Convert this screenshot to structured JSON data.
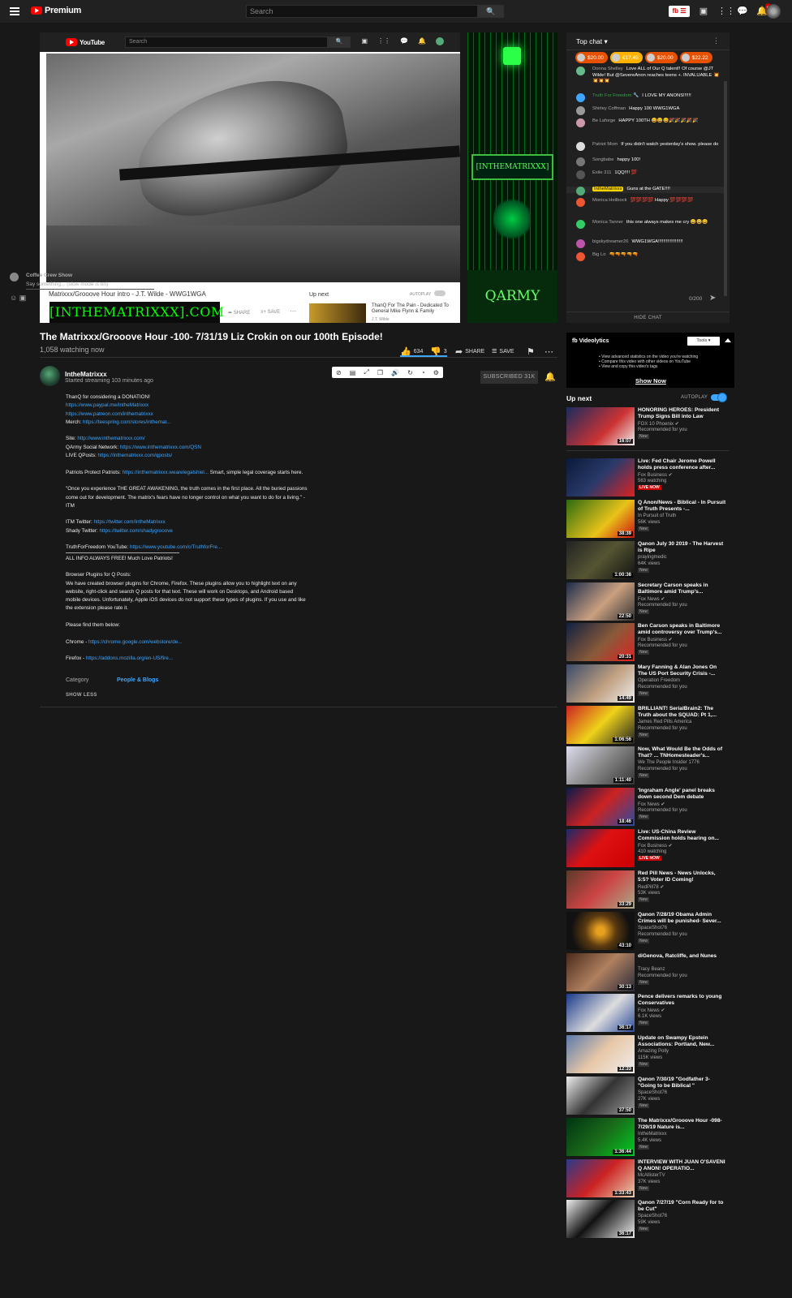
{
  "masthead": {
    "brand": "Premium",
    "search_placeholder": "Search",
    "notif_count": "9"
  },
  "inner_player": {
    "search_placeholder": "Search",
    "logo_text": "YouTube",
    "clip_title": "Matrixxx/Grooove Hour intro - J.T. Wilde - WWG1WGA",
    "banner_text": "[INTHEMATRIXXX].COM",
    "share": "SHARE",
    "save": "SAVE",
    "upnext": "Up next",
    "autoplay": "AUTOPLAY",
    "next_title": "ThanQ For The Pain - Dedicated To General Mike Flynn & Family",
    "next_channel": "J.T. Wilde"
  },
  "matrix_side": {
    "sign_text": "[INTHEMATRIXXX]",
    "qarmy": "QARMY"
  },
  "video": {
    "title": "The Matrixxx/Grooove Hour -100- 7/31/19 Liz Crokin on our 100th Episode!",
    "views": "1,058 watching now",
    "likes": "634",
    "dislikes": "3",
    "share": "SHARE",
    "save": "SAVE"
  },
  "owner": {
    "name": "IntheMatrixxx",
    "started": "Started streaming 103 minutes ago",
    "subscribe": "SUBSCRIBED  31K"
  },
  "description": {
    "lines": [
      {
        "t": "ThanQ for considering a DONATION!"
      },
      {
        "l": "https://www.paypal.me/IntheMatrixxx"
      },
      {
        "l": "https://www.patreon.com/inthematrixxx"
      },
      {
        "t": "Merch: ",
        "l": "https://teespring.com/stores/inthemat..."
      },
      {
        "gap": true
      },
      {
        "t": "Site: ",
        "l": "http://www.inthematrixxx.com/"
      },
      {
        "t": "QArmy Social Network: ",
        "l": "https://www.inthematrixxx.com/QSN"
      },
      {
        "t": "LIVE QPosts: ",
        "l": "https://inthematrixxx.com/qposts/"
      },
      {
        "gap": true
      },
      {
        "t": "Patriots Protect Patriots: ",
        "l": "https://inthematrixxx.wearelegalshiel...",
        "t2": " Smart, simple legal coverage starts here."
      },
      {
        "gap": true
      },
      {
        "t": "\"Once you experience THE GREAT AWAKENING, the truth comes in the first place. All the buried passions"
      },
      {
        "t": "come out for development. The matrix's fears have no longer control on what you want to do for a living.\" -"
      },
      {
        "t": "ITM"
      },
      {
        "gap": true
      },
      {
        "t": "ITM Twitter: ",
        "l": "https://twitter.com/IntheMatrixxx"
      },
      {
        "t": "Shady Twitter: ",
        "l": "https://twitter.com/shadygrooove"
      },
      {
        "gap": true
      },
      {
        "t": "TruthForFreedom YouTube: ",
        "l": "https://www.youtube.com/c/TruthforFre..."
      },
      {
        "rule": true
      },
      {
        "t": "ALL INFO ALWAYS FREE! Much Love Patriots!"
      },
      {
        "gap": true
      },
      {
        "t": "Browser Plugins for Q Posts:"
      },
      {
        "t": "We have created browser plugins for Chrome, Firefox.  These plugins allow you to highlight text on any"
      },
      {
        "t": "website, right-click and search Q posts for that text.  These will work on Desktops, and Android based"
      },
      {
        "t": "mobile devices.  Unfortunately, Apple iOS devices do not support these types of plugins.  If you use and like"
      },
      {
        "t": "the extension please rate it."
      },
      {
        "gap": true
      },
      {
        "t": "Please find them below:"
      },
      {
        "gap": true
      },
      {
        "t": "Chrome - ",
        "l": "https://chrome.google.com/webstore/de..."
      },
      {
        "gap": true
      },
      {
        "t": "Firefox - ",
        "l": "https://addons.mozilla.org/en-US/fire..."
      }
    ],
    "category_label": "Category",
    "category_value": "People & Blogs",
    "show_less": "SHOW LESS"
  },
  "chat": {
    "header": "Top chat",
    "tickers": [
      {
        "amount": "$20.00",
        "color": "#e65100"
      },
      {
        "amount": "€17.45",
        "color": "#ffb300"
      },
      {
        "amount": "$20.00",
        "color": "#e65100"
      },
      {
        "amount": "$22.22",
        "color": "#e65100"
      }
    ],
    "messages": [
      {
        "author": "Donna Shelley",
        "text": "Love ALL of Our Q talent!! Of course @JT Wilde! But @SevereAnon reaches teens +. INVALUABLE 💥💥💥💥",
        "style": ""
      },
      {
        "author": "Truth For Freedom 🔧",
        "text": "I LOVE MY ANONS!!!!!!",
        "style": "mem"
      },
      {
        "author": "Shirley Coffman",
        "text": "Happy 100 WWG1WGA",
        "style": ""
      },
      {
        "author": "Be Laforge",
        "text": "HAPPY 100TH 😀😀😀🎉🎉🎉🎉🎉",
        "style": ""
      },
      {
        "author": "Patriot Mom",
        "text": "If you didn't watch yesterday's show. please do",
        "style": ""
      },
      {
        "author": "Songbabe",
        "text": "happy 100!",
        "style": ""
      },
      {
        "author": "Exile 311",
        "text": "1QQ!!!! 💯",
        "style": ""
      },
      {
        "author": "IntheMatrixxx",
        "text": "Guns at the GATE!!!!",
        "style": "hl"
      },
      {
        "author": "Monica Heilbock",
        "text": "💯💯💯💯 Happy 💯💯💯💯",
        "style": ""
      },
      {
        "author": "Monica Tanner",
        "text": "this one always makes me cry 😀😀😀",
        "style": ""
      },
      {
        "author": "bigskydreamer26",
        "text": "WWG1WGA!!!!!!!!!!!!!!!!!!!",
        "style": ""
      },
      {
        "author": "Big Lo",
        "text": "🔫🔫🔫🔫🔫",
        "style": ""
      }
    ],
    "input_name": "Coffee Crew Show",
    "input_placeholder": "Say something... (slow mode is on)",
    "counter": "0/200",
    "hide_chat": "HIDE CHAT"
  },
  "videolytics": {
    "title": "Videolytics",
    "tools": "Tools",
    "bullets": [
      "View advanced statistics on the video you're watching",
      "Compare this video with other videos on YouTube",
      "View and copy this video's tags"
    ],
    "show_now": "Show Now"
  },
  "sidebar": {
    "upnext": "Up next",
    "autoplay": "AUTOPLAY",
    "items": [
      {
        "title": "HONORING HEROES: President Trump Signs Bill into Law",
        "channel": "FOX 10 Phoenix ✔",
        "meta": "Recommended for you",
        "badge": "New",
        "dur": "16:07",
        "bg": "linear-gradient(135deg,#1a2b5e,#c33 60%,#eee)"
      },
      {
        "title": "Live: Fed Chair Jerome Powell holds press conference after...",
        "channel": "Fox Business ✔",
        "meta": "563 watching",
        "badge": "LIVE NOW",
        "dur": "",
        "bg": "linear-gradient(135deg,#0a1a3a,#2a3a6a 50%,#d22)"
      },
      {
        "title": "Q Anon/News - Biblical - In Pursuit of Truth Presents -...",
        "channel": "In Pursuit of Truth",
        "meta": "56K views",
        "badge": "New",
        "dur": "38:39",
        "bg": "linear-gradient(135deg,#2c6b10,#e8c31a 60%,#c11)"
      },
      {
        "title": "Qanon July 30 2019 - The Harvest is Ripe",
        "channel": "prayingmedic",
        "meta": "64K views",
        "badge": "New",
        "dur": "1:00:36",
        "bg": "linear-gradient(135deg,#222,#553 50%,#111)"
      },
      {
        "title": "Secretary Carson speaks in Baltimore amid Trump's...",
        "channel": "Fox News ✔",
        "meta": "Recommended for you",
        "badge": "New",
        "dur": "22:50",
        "bg": "linear-gradient(135deg,#1c2c4c,#caa080 55%,#333)"
      },
      {
        "title": "Ben Carson speaks in Baltimore amid controversy over Trump's...",
        "channel": "Fox Business ✔",
        "meta": "Recommended for you",
        "badge": "New",
        "dur": "20:31",
        "bg": "linear-gradient(135deg,#102040,#8a5a3a 55%,#d22)"
      },
      {
        "title": "Mary Fanning & Alan Jones On The US Port Security Crisis -...",
        "channel": "Operation Freedom",
        "meta": "Recommended for you",
        "badge": "New",
        "dur": "14:49",
        "bg": "linear-gradient(135deg,#3a4a6a,#c0a080 55%,#eee)"
      },
      {
        "title": "BRILLIANT! SerialBrain2: The Truth about the SQUAD: Pt 1,...",
        "channel": "James Red Pills America",
        "meta": "Recommended for you",
        "badge": "New",
        "dur": "1:06:56",
        "bg": "linear-gradient(135deg,#c22,#eed21a 50%,#222)"
      },
      {
        "title": "Now, What Would Be the Odds of That? ... TNHomesteader's...",
        "channel": "We The People Insider 1776",
        "meta": "Recommended for you",
        "badge": "New",
        "dur": "1:11:40",
        "bg": "linear-gradient(135deg,#dde,#888 50%,#333)"
      },
      {
        "title": "'Ingraham Angle' panel breaks down second Dem debate",
        "channel": "Fox News ✔",
        "meta": "Recommended for you",
        "badge": "New",
        "dur": "18:46",
        "bg": "linear-gradient(135deg,#0a1a4a,#c22 50%,#2a4aa0)"
      },
      {
        "title": "Live: US-China Review Commission holds hearing on...",
        "channel": "Fox Business ✔",
        "meta": "410 watching",
        "badge": "LIVE NOW",
        "dur": "",
        "bg": "linear-gradient(135deg,#1a2a6a,#d11 45%,#c00)"
      },
      {
        "title": "Red Pill News - News Unlocks, 5:5? Voter ID Coming!",
        "channel": "RedPill78 ✔",
        "meta": "53K views",
        "badge": "New",
        "dur": "33:29",
        "bg": "linear-gradient(135deg,#5a3a2a,#c44 50%,#aa8)"
      },
      {
        "title": "Qanon 7/28/19 Obama Admin Crimes will be punished- Sever...",
        "channel": "SpaceShot76",
        "meta": "Recommended for you",
        "badge": "New",
        "dur": "43:10",
        "bg": "radial-gradient(circle,#e8a020 10%,#5a3a10 40%,#111 75%)"
      },
      {
        "title": "diGenova, Ratcliffe, and Nunes",
        "channel": "Tracy Beanz",
        "meta": "Recommended for you",
        "badge": "New",
        "dur": "30:13",
        "bg": "linear-gradient(135deg,#4a2a1a,#b08060 50%,#2a2a3a)"
      },
      {
        "title": "Pence delivers remarks to young Conservatives",
        "channel": "Fox News ✔",
        "meta": "6.1K views",
        "badge": "New",
        "dur": "36:17",
        "bg": "linear-gradient(135deg,#1a3a8a,#ddd 55%,#2a4a9a)"
      },
      {
        "title": "Update on Swampy Epstein Associations: Portland, New...",
        "channel": "Amazing Polly",
        "meta": "115K views",
        "badge": "New",
        "dur": "12:33",
        "bg": "linear-gradient(135deg,#5a7aaa,#e8c8a8 50%,#eee)"
      },
      {
        "title": "Qanon 7/30/19 \"Godfather 3- \"Going to be Biblical \"",
        "channel": "SpaceShot76",
        "meta": "27K views",
        "badge": "New",
        "dur": "37:50",
        "bg": "linear-gradient(135deg,#eee,#333 50%,#999)"
      },
      {
        "title": "The Matrixxx/Grooove Hour -098- 7/29/19 Nature is...",
        "channel": "IntheMatrixxx",
        "meta": "5.4K views",
        "badge": "New",
        "dur": "1:36:44",
        "bg": "linear-gradient(135deg,#031,#1a6a1a 50%,#0c2)"
      },
      {
        "title": "INTERVIEW WITH JUAN O'SAVENI Q ANON! OPERATIO...",
        "channel": "McAllisterTV",
        "meta": "37K views",
        "badge": "New",
        "dur": "1:33:43",
        "bg": "linear-gradient(135deg,#2a3a8a,#c22 50%,#e8d0b0)"
      },
      {
        "title": "Qanon 7/27/19 \"Corn Ready for to be Cut\"",
        "channel": "SpaceShot76",
        "meta": "59K views",
        "badge": "New",
        "dur": "36:17",
        "bg": "linear-gradient(135deg,#eee,#111 45%,#eee)"
      }
    ]
  }
}
